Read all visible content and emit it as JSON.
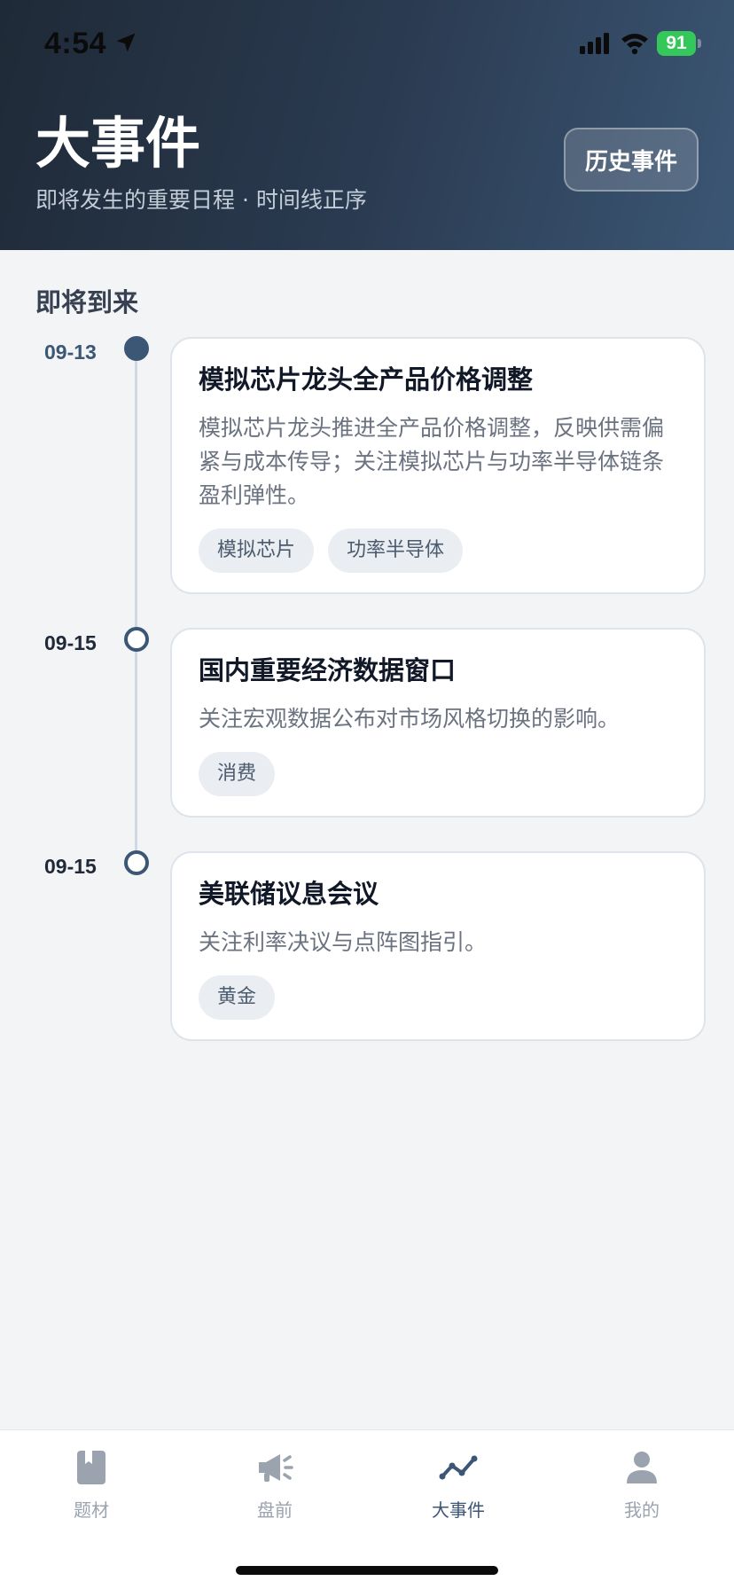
{
  "status_bar": {
    "time": "4:54",
    "battery": "91",
    "icons": [
      "location-arrow-icon",
      "cellular-signal-icon",
      "wifi-icon",
      "battery-charging-icon"
    ]
  },
  "header": {
    "title": "大事件",
    "subtitle": "即将发生的重要日程 · 时间线正序",
    "history_button": "历史事件"
  },
  "section_title": "即将到来",
  "events": [
    {
      "date": "09-13",
      "title": "模拟芯片龙头全产品价格调整",
      "description": "模拟芯片龙头推进全产品价格调整，反映供需偏紧与成本传导；关注模拟芯片与功率半导体链条盈利弹性。",
      "tags": [
        "模拟芯片",
        "功率半导体"
      ]
    },
    {
      "date": "09-15",
      "title": "国内重要经济数据窗口",
      "description": "关注宏观数据公布对市场风格切换的影响。",
      "tags": [
        "消费"
      ]
    },
    {
      "date": "09-15",
      "title": "美联储议息会议",
      "description": "关注利率决议与点阵图指引。",
      "tags": [
        "黄金"
      ]
    }
  ],
  "tabbar": {
    "items": [
      {
        "label": "题材",
        "icon": "book-icon",
        "active": false
      },
      {
        "label": "盘前",
        "icon": "megaphone-icon",
        "active": false
      },
      {
        "label": "大事件",
        "icon": "trend-line-icon",
        "active": true
      },
      {
        "label": "我的",
        "icon": "person-icon",
        "active": false
      }
    ]
  },
  "colors": {
    "accent": "#3c5676",
    "header_dark": "#1f2a37",
    "page_background": "#f3f4f6",
    "battery_green": "#34c759",
    "tab_inactive": "#9aa3ae"
  }
}
